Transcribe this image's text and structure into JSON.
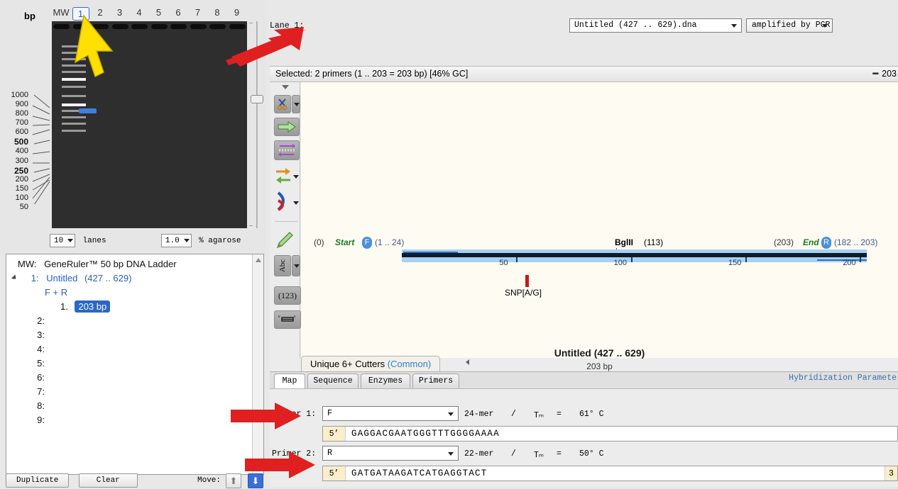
{
  "gel": {
    "bp_axis_label": "bp",
    "lane_headers": [
      "MW",
      "1",
      "2",
      "3",
      "4",
      "5",
      "6",
      "7",
      "8",
      "9"
    ],
    "selected_lane": "1",
    "ladder_labels": [
      "1000",
      "900",
      "800",
      "700",
      "600",
      "500",
      "400",
      "300",
      "250",
      "200",
      "150",
      "100",
      "50"
    ],
    "bold_ladder_labels": [
      "500",
      "250"
    ],
    "lanes_count_value": "10",
    "lanes_label": "lanes",
    "agarose_value": "1.0",
    "agarose_label": "% agarose",
    "sample_band_color": "#3f7fe0",
    "gel_background": "#2e2e2e"
  },
  "lane_list": {
    "mw_prefix": "MW:",
    "mw_name": "GeneRuler™ 50 bp DNA Ladder",
    "lane1_num": "1:",
    "lane1_name": "Untitled",
    "lane1_range": "(427 .. 629)",
    "lane1_primers": "F + R",
    "lane1_product_index": "1.",
    "lane1_product": "203 bp",
    "empty_lanes": [
      "2:",
      "3:",
      "4:",
      "5:",
      "6:",
      "7:",
      "8:",
      "9:"
    ],
    "footer": {
      "duplicate": "Duplicate",
      "clear": "Clear",
      "move_label": "Move:",
      "up_icon": "up-arrow-icon",
      "down_icon": "down-arrow-icon"
    }
  },
  "lane_header_row": {
    "lane_label": "Lane 1:",
    "file_value": "Untitled  (427 .. 629).dna",
    "method_value": "amplified by PCR"
  },
  "editor": {
    "selected_text": "Selected: 2 primers (1 .. 203 = 203 bp)   [46% GC]",
    "selected_right": "203",
    "toolbar": [
      {
        "name": "scissors-icon",
        "has_dropdown": true
      },
      {
        "name": "green-arrow-icon",
        "has_dropdown": false
      },
      {
        "name": "purple-strand-icon",
        "has_dropdown": false
      },
      {
        "name": "orange-green-arrows-icon",
        "has_dropdown": true
      },
      {
        "name": "red-blue-curve-icon",
        "has_dropdown": true
      },
      {
        "name": "pen-icon",
        "has_dropdown": false
      },
      {
        "name": "abc-icon",
        "has_dropdown": true
      },
      {
        "name": "numbers-123-icon",
        "has_dropdown": false
      },
      {
        "name": "ruler-icon",
        "has_dropdown": false
      }
    ],
    "cutters_tab": "Unique 6+ Cutters",
    "cutters_tab_common": "(Common)",
    "tabs": [
      {
        "label": "Map",
        "active": true
      },
      {
        "label": "Sequence",
        "active": false
      },
      {
        "label": "Enzymes",
        "active": false
      },
      {
        "label": "Primers",
        "active": false
      }
    ],
    "hybridization_link": "Hybridization Paramete"
  },
  "map": {
    "start_pos": "(0)",
    "start_word": "Start",
    "start_badge": "F",
    "start_range": "(1 .. 24)",
    "end_pos": "(203)",
    "end_word": "End",
    "end_badge": "R",
    "end_range": "(182 .. 203)",
    "enzyme_name": "BglII",
    "enzyme_pos": "(113)",
    "snp_label": "SNP[A/G]",
    "ruler_ticks": [
      "50",
      "100",
      "150",
      "200"
    ],
    "title": "Untitled  (427 .. 629)",
    "subtitle": "203 bp",
    "sequence_length": 203,
    "backbone_color": "#a9d0f0",
    "primer_line_color": "#2b6fc4",
    "snp_color": "#c21d1d"
  },
  "primers": [
    {
      "label": "Primer 1:",
      "name": "F",
      "length": "24-mer",
      "slash": "/",
      "tm_label": "Tₘ",
      "eq": "=",
      "tm_value": "61° C",
      "five_prime": "5’",
      "sequence": "GAGGACGAATGGGTTTGGGGAAAA",
      "three_prime": ""
    },
    {
      "label": "Primer 2:",
      "name": "R",
      "length": "22-mer",
      "slash": "/",
      "tm_label": "Tₘ",
      "eq": "=",
      "tm_value": "50° C",
      "five_prime": "5’",
      "sequence": "GATGATAAGATCATGAGGTACT",
      "three_prime": "3"
    }
  ],
  "annotations": {
    "yellow_cursor_color": "#ffe000",
    "red_arrow_color": "#e02020",
    "arrow_count": 3
  }
}
